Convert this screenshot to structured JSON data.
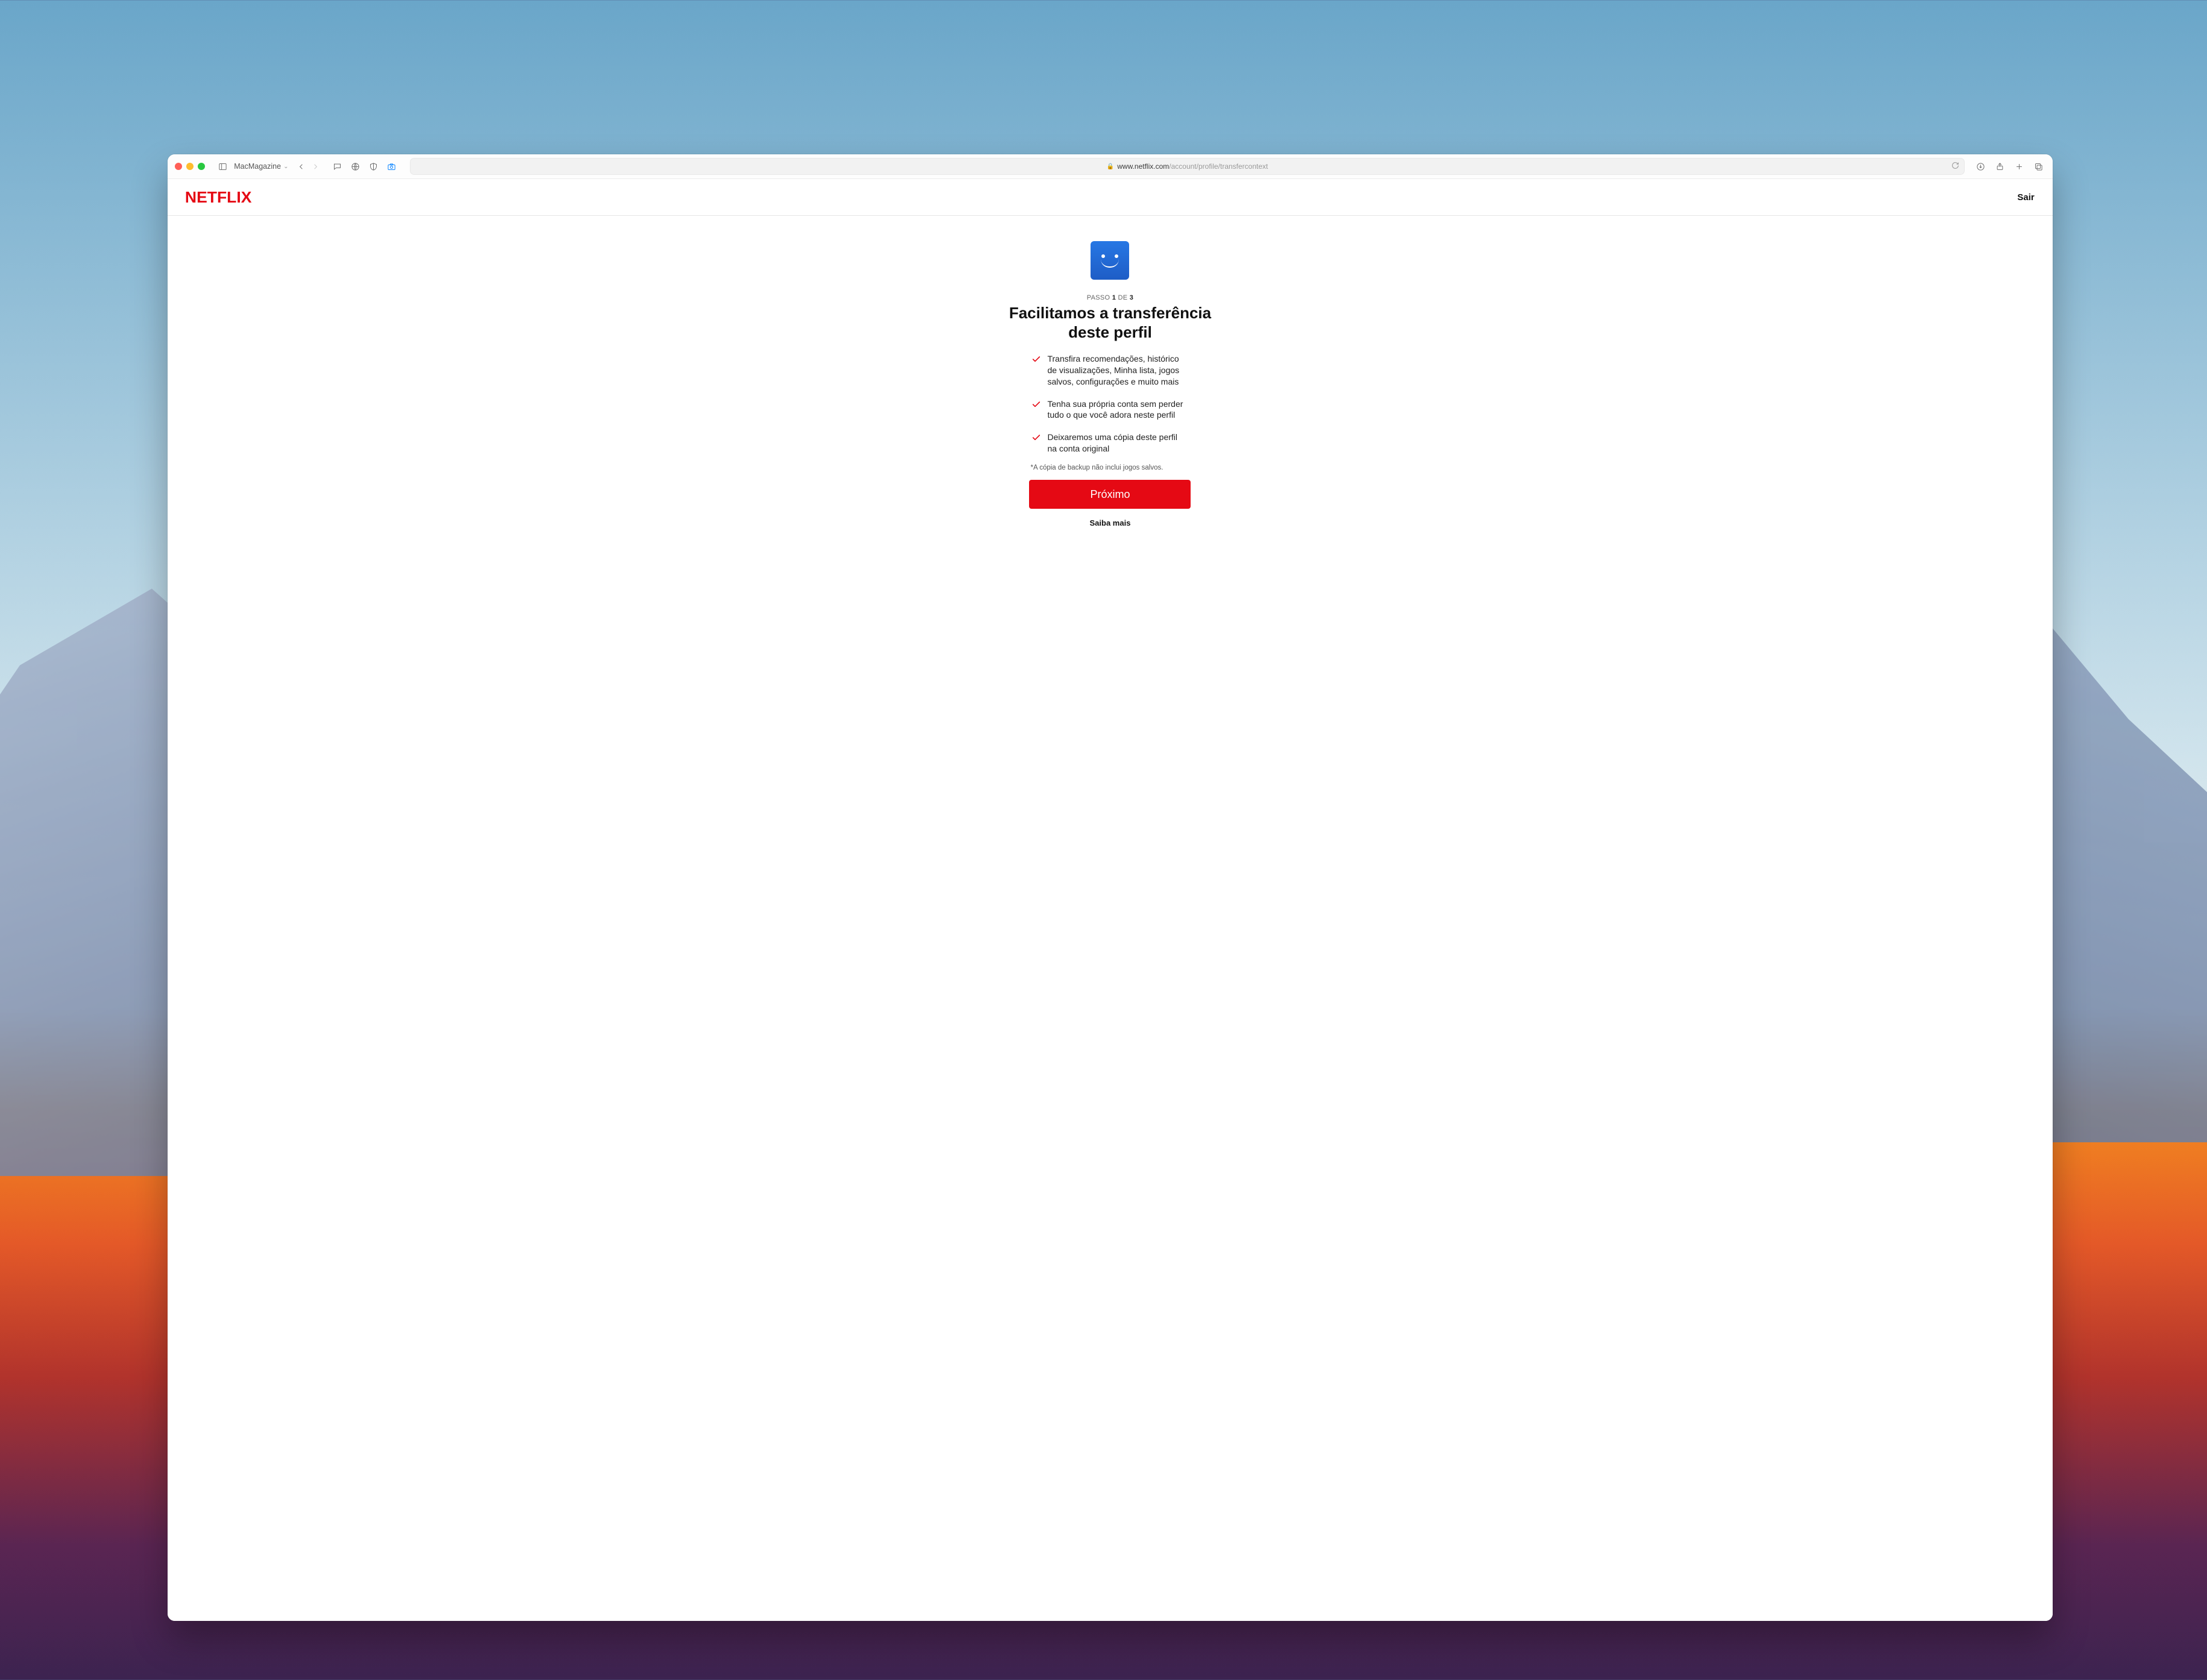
{
  "browser": {
    "tab_group_name": "MacMagazine",
    "url_host": "www.netflix.com",
    "url_path": "/account/profile/transfercontext"
  },
  "header": {
    "logo_text": "NETFLIX",
    "sign_out": "Sair"
  },
  "step": {
    "prefix": "PASSO",
    "current": "1",
    "separator": "DE",
    "total": "3"
  },
  "title": "Facilitamos a transferência deste perfil",
  "bullets": [
    "Transfira recomendações, histórico de visualizações, Minha lista, jogos salvos, configurações e muito mais",
    "Tenha sua própria conta sem perder tudo o que você adora neste perfil",
    "Deixaremos uma cópia deste perfil na conta original"
  ],
  "footnote": "*A cópia de backup não inclui jogos salvos.",
  "cta": "Próximo",
  "learn_more": "Saiba mais"
}
